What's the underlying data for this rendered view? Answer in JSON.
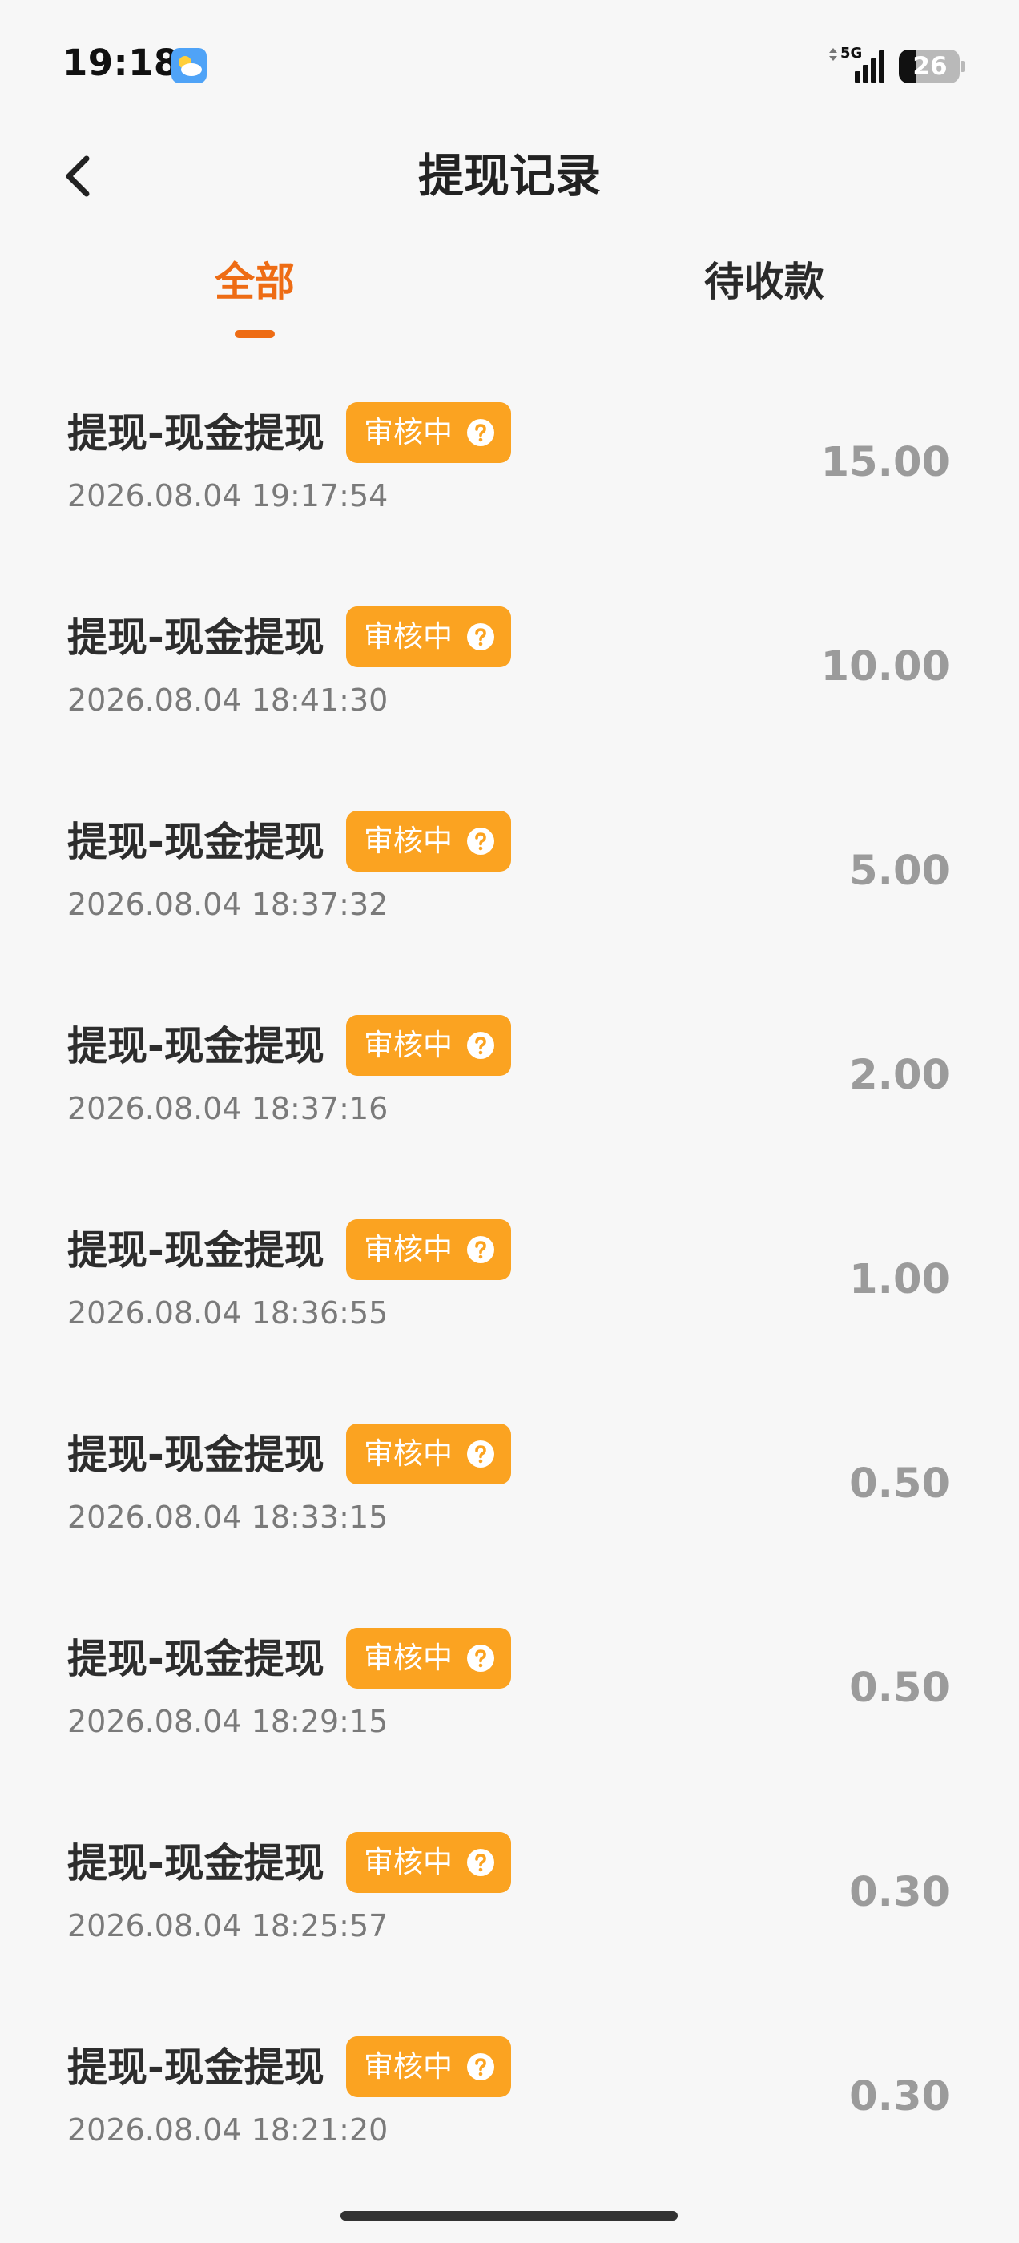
{
  "status_bar": {
    "time": "19:18",
    "weather_icon": "weather-icon",
    "network_label": "5G",
    "battery_level": "26"
  },
  "header": {
    "title": "提现记录",
    "back_icon": "chevron-left-icon"
  },
  "tabs": [
    {
      "label": "全部",
      "active": true
    },
    {
      "label": "待收款",
      "active": false
    }
  ],
  "colors": {
    "accent": "#ee6c14",
    "badge": "#fba321",
    "amount": "#9b9b9b",
    "time": "#7a7a7a"
  },
  "records": [
    {
      "title": "提现-现金提现",
      "status": "审核中",
      "status_icon": "question-icon",
      "time": "2026.08.04 19:17:54",
      "amount": "15.00"
    },
    {
      "title": "提现-现金提现",
      "status": "审核中",
      "status_icon": "question-icon",
      "time": "2026.08.04 18:41:30",
      "amount": "10.00"
    },
    {
      "title": "提现-现金提现",
      "status": "审核中",
      "status_icon": "question-icon",
      "time": "2026.08.04 18:37:32",
      "amount": "5.00"
    },
    {
      "title": "提现-现金提现",
      "status": "审核中",
      "status_icon": "question-icon",
      "time": "2026.08.04 18:37:16",
      "amount": "2.00"
    },
    {
      "title": "提现-现金提现",
      "status": "审核中",
      "status_icon": "question-icon",
      "time": "2026.08.04 18:36:55",
      "amount": "1.00"
    },
    {
      "title": "提现-现金提现",
      "status": "审核中",
      "status_icon": "question-icon",
      "time": "2026.08.04 18:33:15",
      "amount": "0.50"
    },
    {
      "title": "提现-现金提现",
      "status": "审核中",
      "status_icon": "question-icon",
      "time": "2026.08.04 18:29:15",
      "amount": "0.50"
    },
    {
      "title": "提现-现金提现",
      "status": "审核中",
      "status_icon": "question-icon",
      "time": "2026.08.04 18:25:57",
      "amount": "0.30"
    },
    {
      "title": "提现-现金提现",
      "status": "审核中",
      "status_icon": "question-icon",
      "time": "2026.08.04 18:21:20",
      "amount": "0.30"
    }
  ]
}
